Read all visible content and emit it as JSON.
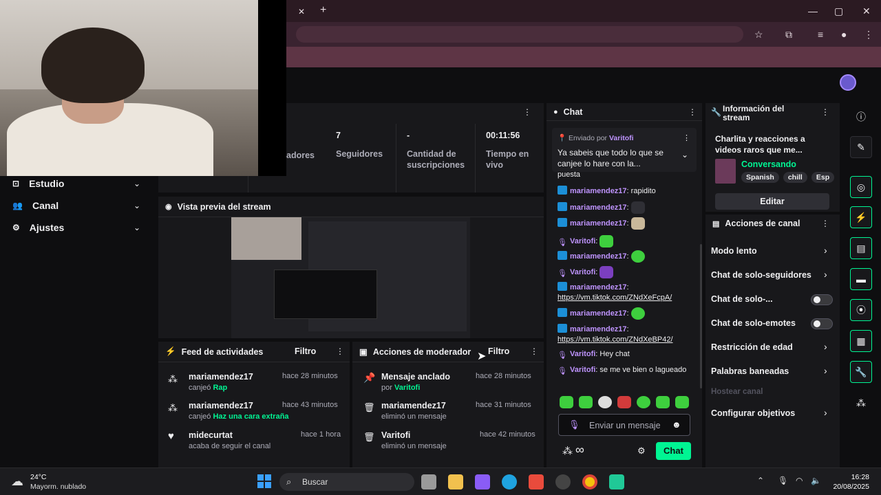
{
  "browser": {
    "tab_close": "✕",
    "new_tab": "+",
    "window_controls": [
      "—",
      "▢",
      "✕"
    ]
  },
  "left_nav": {
    "items": [
      {
        "label": "Estudio",
        "icon": "studio-icon"
      },
      {
        "label": "Canal",
        "icon": "people-icon"
      },
      {
        "label": "Ajustes",
        "icon": "gear-icon"
      }
    ]
  },
  "stats": [
    {
      "value": "",
      "label": "adores"
    },
    {
      "value": "7",
      "label": "Seguidores"
    },
    {
      "value": "-",
      "label": "Cantidad de suscripciones"
    },
    {
      "value": "00:11:56",
      "label": "Tiempo en vivo"
    }
  ],
  "preview": {
    "title": "Vista previa del stream"
  },
  "activity_feed": {
    "title": "Feed de actividades",
    "filter": "Filtro",
    "items": [
      {
        "name": "mariamendez17",
        "action": "canjeó",
        "reward": "Rap",
        "time": "hace 28 minutos"
      },
      {
        "name": "mariamendez17",
        "action": "canjeó",
        "reward": "Haz una cara extraña",
        "time": "hace 43 minutos"
      },
      {
        "name": "midecurtat",
        "action": "acaba de seguir el canal",
        "reward": "",
        "time": "hace 1 hora"
      }
    ]
  },
  "mod_actions": {
    "title": "Acciones de moderador",
    "filter": "Filtro",
    "items": [
      {
        "name": "Mensaje anclado",
        "sub_prefix": "por",
        "sub_user": "Varitofi",
        "time": "hace 28 minutos"
      },
      {
        "name": "mariamendez17",
        "sub": "eliminó un mensaje",
        "time": "hace 31 minutos"
      },
      {
        "name": "Varitofi",
        "sub": "eliminó un mensaje",
        "time": "hace 42 minutos"
      }
    ]
  },
  "chat": {
    "title": "Chat",
    "pinned": {
      "sent_by_label": "Enviado por",
      "sent_by_user": "Varitofi",
      "text": "Ya sabeis que todo lo que se canjee lo hare con la..."
    },
    "partial_above": "puesta",
    "messages": [
      {
        "user": "mariamendez17",
        "color": "#bf94ff",
        "badge": "prime",
        "text": "rapidito"
      },
      {
        "user": "mariamendez17",
        "color": "#bf94ff",
        "badge": "prime",
        "text": ""
      },
      {
        "user": "mariamendez17",
        "color": "#bf94ff",
        "badge": "prime",
        "text": ""
      },
      {
        "user": "Varitofi",
        "color": "#bf94ff",
        "badge": "mic",
        "text": ""
      },
      {
        "user": "mariamendez17",
        "color": "#bf94ff",
        "badge": "prime",
        "text": ""
      },
      {
        "user": "Varitofi",
        "color": "#bf94ff",
        "badge": "mic",
        "text": ""
      },
      {
        "user": "mariamendez17",
        "color": "#bf94ff",
        "badge": "prime",
        "text": "",
        "link": "https://vm.tiktok.com/ZNdXeFcpA/"
      },
      {
        "user": "mariamendez17",
        "color": "#bf94ff",
        "badge": "prime",
        "text": ""
      },
      {
        "user": "mariamendez17",
        "color": "#bf94ff",
        "badge": "prime",
        "text": "",
        "link": "https://vm.tiktok.com/ZNdXeBP42/"
      },
      {
        "user": "Varitofi",
        "color": "#bf94ff",
        "badge": "mic",
        "text": "Hey chat"
      },
      {
        "user": "Varitofi",
        "color": "#bf94ff",
        "badge": "mic",
        "text": "se me ve bien o lagueado"
      }
    ],
    "input_placeholder": "Enviar un mensaje",
    "send_label": "Chat",
    "infinity": "∞"
  },
  "stream_info": {
    "title": "Información del stream",
    "stream_title": "Charlita y reacciones a videos raros que me...",
    "category": "Conversando",
    "tags": [
      "Spanish",
      "chill",
      "Esp"
    ],
    "edit_label": "Editar"
  },
  "channel_actions": {
    "title": "Acciones de canal",
    "items": [
      {
        "label": "Modo lento",
        "control": "chevron"
      },
      {
        "label": "Chat de solo-seguidores",
        "control": "chevron"
      },
      {
        "label": "Chat de solo-...",
        "control": "toggle"
      },
      {
        "label": "Chat de solo-emotes",
        "control": "toggle"
      },
      {
        "label": "Restricción de edad",
        "control": "chevron"
      },
      {
        "label": "Palabras baneadas",
        "control": "chevron"
      },
      {
        "label": "Hostear canal",
        "control": "disabled"
      },
      {
        "label": "Configurar objetivos",
        "control": "chevron"
      }
    ]
  },
  "taskbar": {
    "weather_temp": "24°C",
    "weather_desc": "Mayorm. nublado",
    "search_placeholder": "Buscar",
    "time": "16:28",
    "date": "20/08/2025"
  },
  "colors": {
    "accent": "#9147ff",
    "green": "#00f593",
    "chat_button": "#00f593",
    "panel": "#18181b",
    "background": "#0e0e10"
  }
}
